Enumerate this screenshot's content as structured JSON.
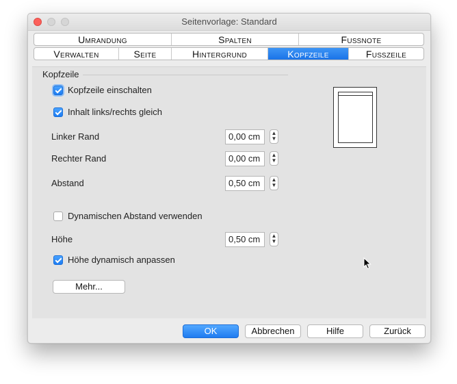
{
  "window": {
    "title": "Seitenvorlage: Standard"
  },
  "tabs": {
    "row1": [
      {
        "label": "Umrandung"
      },
      {
        "label": "Spalten"
      },
      {
        "label": "Fußnote"
      }
    ],
    "row2": [
      {
        "label": "Verwalten"
      },
      {
        "label": "Seite"
      },
      {
        "label": "Hintergrund"
      },
      {
        "label": "Kopfzeile",
        "active": true
      },
      {
        "label": "Fußzeile"
      }
    ]
  },
  "section": {
    "label": "Kopfzeile"
  },
  "options": {
    "header_on": {
      "label": "Kopfzeile einschalten",
      "checked": true
    },
    "same_content": {
      "label": "Inhalt links/rechts gleich",
      "checked": true
    },
    "dynamic_spacing": {
      "label": "Dynamischen Abstand verwenden",
      "checked": false
    },
    "autofit_height": {
      "label": "Höhe dynamisch anpassen",
      "checked": true
    }
  },
  "fields": {
    "left_margin": {
      "label": "Linker Rand",
      "value": "0,00 cm"
    },
    "right_margin": {
      "label": "Rechter Rand",
      "value": "0,00 cm"
    },
    "spacing": {
      "label": "Abstand",
      "value": "0,50 cm"
    },
    "height": {
      "label": "Höhe",
      "value": "0,50 cm"
    }
  },
  "buttons": {
    "more": "Mehr...",
    "ok": "OK",
    "cancel": "Abbrechen",
    "help": "Hilfe",
    "reset": "Zurück"
  },
  "colors": {
    "accent": "#1a73e8",
    "close_button": "#fc605b"
  }
}
